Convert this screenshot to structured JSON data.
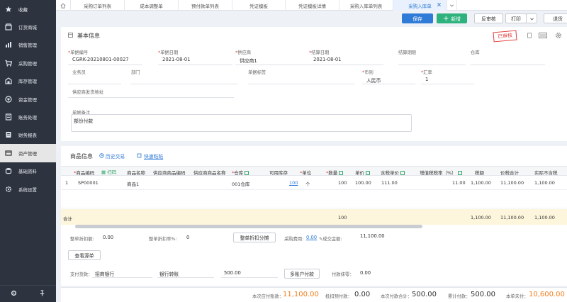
{
  "sidebar": {
    "items": [
      {
        "label": "收藏",
        "icon": "star-icon"
      },
      {
        "label": "订货商城",
        "icon": "shop-icon"
      },
      {
        "label": "销售管理",
        "icon": "sales-icon"
      },
      {
        "label": "采购管理",
        "icon": "cart-icon"
      },
      {
        "label": "库存管理",
        "icon": "warehouse-icon"
      },
      {
        "label": "资金管理",
        "icon": "money-icon"
      },
      {
        "label": "账务处理",
        "icon": "ledger-icon"
      },
      {
        "label": "财务报表",
        "icon": "report-icon"
      },
      {
        "label": "资产管理",
        "icon": "asset-icon"
      },
      {
        "label": "基础资料",
        "icon": "database-icon"
      },
      {
        "label": "系统设置",
        "icon": "gear-icon"
      }
    ]
  },
  "tabs": [
    "采购订单列表",
    "成本调整单",
    "预付款单列表",
    "凭证模板",
    "凭证模板详情",
    "采购入库单列表",
    "采购入库单"
  ],
  "toolbar": {
    "save": "保存",
    "add": "新增",
    "unaudit": "反审核",
    "print": "打印",
    "return": "退货"
  },
  "basic": {
    "title": "基本信息",
    "stamp": "已审核",
    "fields": {
      "doc_no_label": "单据编号",
      "doc_no": "CGRK-20210801-00027",
      "doc_date_label": "单据日期",
      "doc_date": "2021-08-01",
      "supplier_label": "供应商",
      "supplier": "供应商1",
      "settle_date_label": "结算日期",
      "settle_date": "2021-08-01",
      "settle_term_label": "结算期限",
      "warehouse_label": "仓库",
      "salesman_label": "业务员",
      "dept_label": "部门",
      "doc_tag_label": "单据标签",
      "currency_label": "币别",
      "currency": "人民币",
      "rate_label": "汇率",
      "rate": "1",
      "address_label": "供应商发货地址",
      "remark_label": "单据备注",
      "remark": "部份付款"
    }
  },
  "goods": {
    "title": "商品信息",
    "history": "历史交易",
    "paste": "快速粘贴",
    "headers": [
      "商品编码",
      "扫码",
      "商品名称",
      "供应商商品编码",
      "供应商商品名称",
      "仓库",
      "可用库存",
      "单位",
      "数量",
      "单价",
      "含税单价",
      "增值税税率（%）",
      "税额",
      "价税合计",
      "实际不含税"
    ],
    "row": {
      "index": "1",
      "code": "SP00001",
      "name": "商品1",
      "warehouse": "001仓库",
      "stock": "100",
      "unit": "个",
      "qty": "100",
      "price": "100.00",
      "tax_price": "111.00",
      "tax_rate": "11.00",
      "tax": "1,100.00",
      "total": "11,100.00",
      "net": "1,100.00"
    },
    "total_row": {
      "label": "合计",
      "qty": "100",
      "tax": "1,100.00",
      "total": "11,100.00",
      "net": "1,100.00"
    }
  },
  "discount": {
    "amount_label": "整单折扣额:",
    "amount": "0.00",
    "rate_label": "整单折扣率%:",
    "rate": "0",
    "split_button": "整单折扣分摊",
    "purchase_fee_label": "采购费用:",
    "purchase_fee": "0.00",
    "deal_amount_label": "成交金额:",
    "deal_amount": "11,100.00",
    "view_source": "查看源单"
  },
  "payment": {
    "pay_label": "支付货款：",
    "bank": "招商银行",
    "method": "银行转账",
    "amount": "500.00",
    "multi_button": "多账户付款",
    "diff_label": "付款抹零：",
    "diff": "0.00"
  },
  "footer": {
    "due_label": "本次应付账款：",
    "due": "11,100.00",
    "prepaid_label": "抵扣预付款：",
    "prepaid": "0.00",
    "paid_label": "本次付款合计：",
    "paid": "500.00",
    "cum_label": "累计付款：",
    "cum": "500.00",
    "unpaid_label": "本单未付：",
    "unpaid": "10,600.00"
  },
  "colors": {
    "accent": "#2f7bd8",
    "green": "#2fb37e",
    "orange": "#f07f1e",
    "sidebar": "#2d3440"
  }
}
